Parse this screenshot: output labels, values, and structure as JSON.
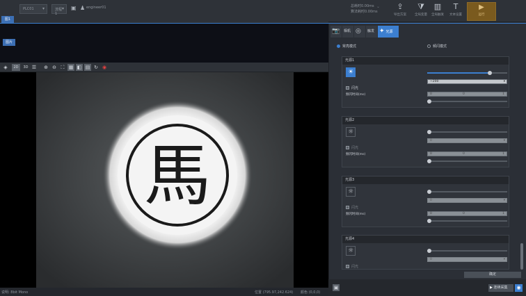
{
  "toolbar": {
    "combo1": "PLC01",
    "combo2": "流程1",
    "user_label": "engineer01",
    "stat1": "总耗时0.00ms",
    "stat2": "算法耗时0.00ms",
    "tools": [
      {
        "icon": "export-icon",
        "glyph": "⇪",
        "label": "导出方案"
      },
      {
        "icon": "filter-icon",
        "glyph": "⧩",
        "label": "全局变量"
      },
      {
        "icon": "control-icon",
        "glyph": "▥",
        "label": "全局触发"
      },
      {
        "icon": "text-icon",
        "glyph": "T",
        "label": "文本设置"
      }
    ],
    "run_label": "运行",
    "run_icon": "play-icon",
    "tab_label": "图1"
  },
  "left_button": "图片",
  "view_tools": {
    "btn_2d": "2D",
    "btn_3d": "3D"
  },
  "status": {
    "left": "说明: 8bit Mono",
    "coords": "位置 (795.97,242.624)",
    "pixel": "颜色 (0,0,0)"
  },
  "panel": {
    "tabs": [
      {
        "icon": "camera-icon",
        "label": "相机"
      },
      {
        "icon": "aperture-icon",
        "label": "触发"
      },
      {
        "icon": "light-icon",
        "label": "光源"
      }
    ],
    "mode_a": "常亮模式",
    "mode_b": "频闪模式",
    "groups": [
      {
        "title": "光源1",
        "select": "~200",
        "strobe": "闪光",
        "range_label": "频闪时间(ms)",
        "range": [
          "0",
          "0",
          "1"
        ],
        "enabled": true
      },
      {
        "title": "光源2",
        "select": "0",
        "strobe": "闪光",
        "range_label": "频闪时间(ms)",
        "range": [
          "0",
          "0",
          "1"
        ],
        "enabled": false
      },
      {
        "title": "光源3",
        "select": "0",
        "strobe": "闪光",
        "range_label": "频闪时间(ms)",
        "range": [
          "0",
          "0",
          "1"
        ],
        "enabled": false
      },
      {
        "title": "光源4",
        "select": "0",
        "strobe": "闪光",
        "enabled": false
      }
    ],
    "ok_label": "确定",
    "bottom_btn_label": "连续采集"
  }
}
